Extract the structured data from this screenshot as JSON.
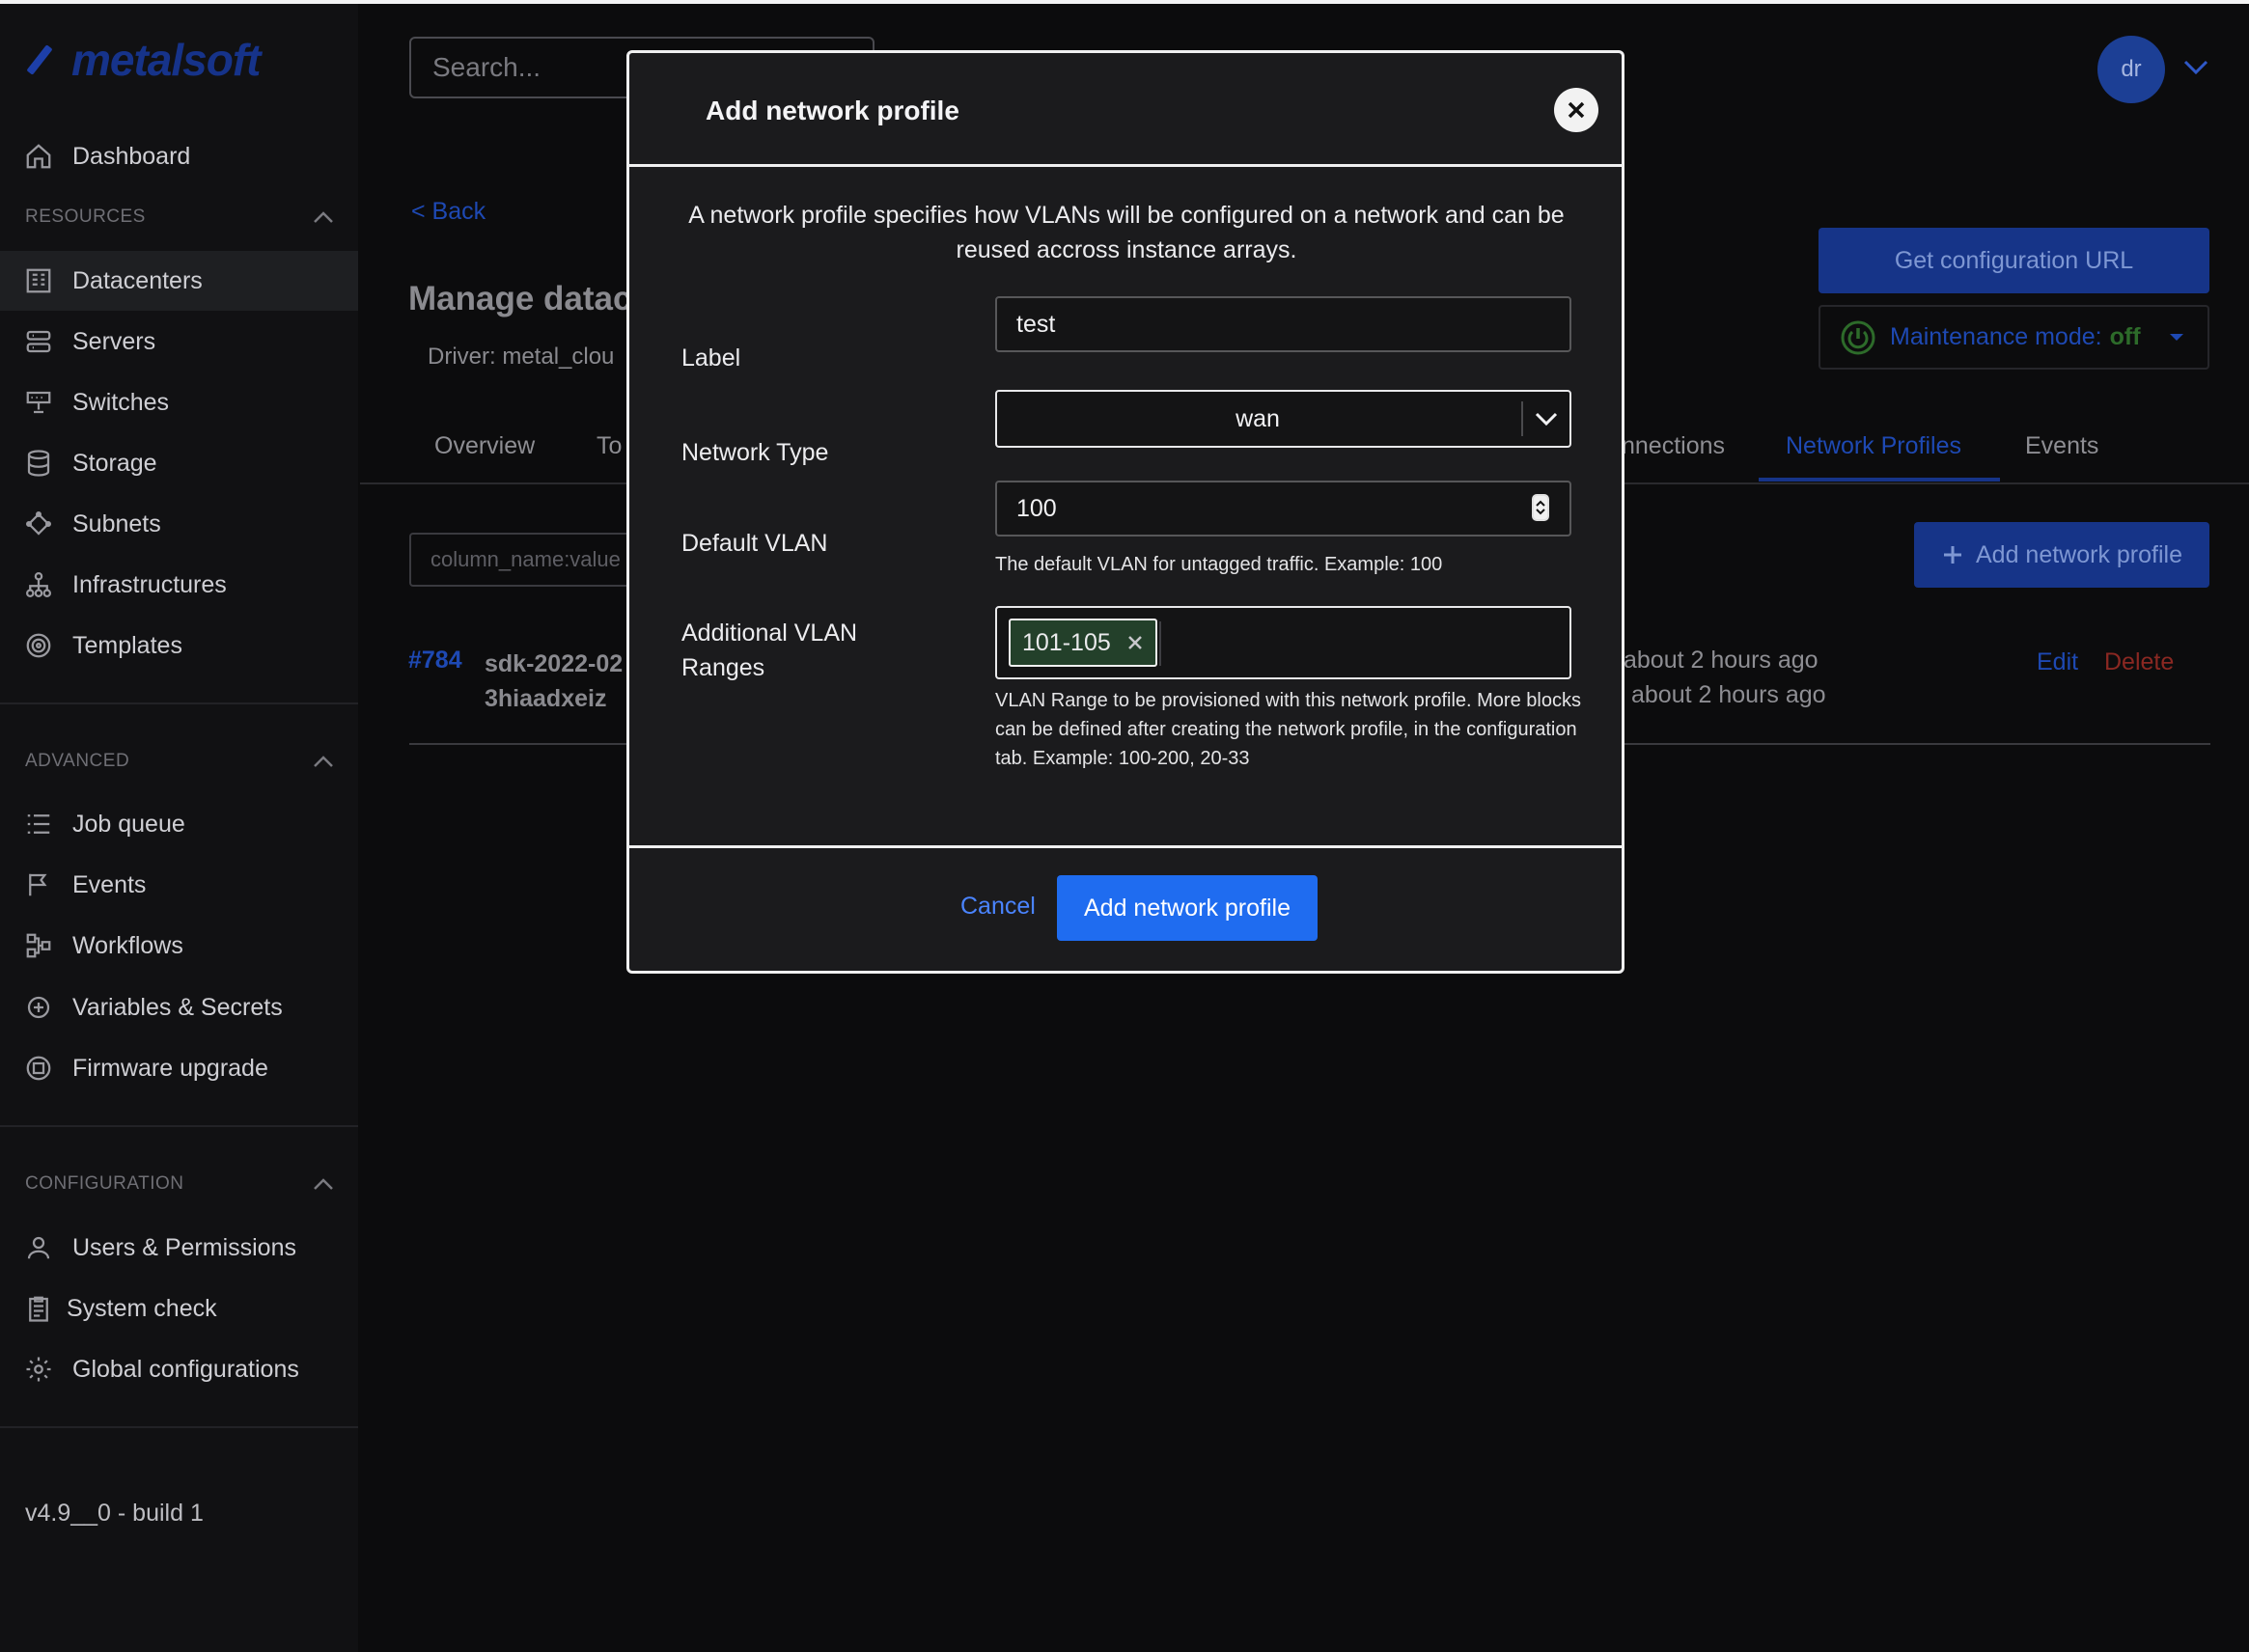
{
  "app": {
    "logo_text": "metalsoft",
    "version": "v4.9__0 - build 1"
  },
  "search": {
    "placeholder": "Search..."
  },
  "user": {
    "initials": "dr"
  },
  "sidebar": {
    "items": [
      {
        "label": "Dashboard",
        "icon": "home-icon"
      },
      {
        "label": "Datacenters",
        "icon": "building-icon"
      },
      {
        "label": "Servers",
        "icon": "server-icon"
      },
      {
        "label": "Switches",
        "icon": "switch-icon"
      },
      {
        "label": "Storage",
        "icon": "database-icon"
      },
      {
        "label": "Subnets",
        "icon": "subnet-icon"
      },
      {
        "label": "Infrastructures",
        "icon": "hierarchy-icon"
      },
      {
        "label": "Templates",
        "icon": "templates-icon"
      },
      {
        "label": "Job queue",
        "icon": "list-icon"
      },
      {
        "label": "Events",
        "icon": "flag-icon"
      },
      {
        "label": "Workflows",
        "icon": "workflow-icon"
      },
      {
        "label": "Variables & Secrets",
        "icon": "secrets-icon"
      },
      {
        "label": "Firmware upgrade",
        "icon": "firmware-icon"
      },
      {
        "label": "Users & Permissions",
        "icon": "user-icon"
      },
      {
        "label": "System check",
        "icon": "clipboard-icon"
      },
      {
        "label": "Global configurations",
        "icon": "gear-icon"
      }
    ],
    "sections": {
      "resources": "RESOURCES",
      "advanced": "ADVANCED",
      "configuration": "CONFIGURATION"
    }
  },
  "page": {
    "back": "< Back",
    "title": "Manage datac",
    "driver": "Driver:  metal_clou",
    "get_config_button": "Get configuration URL",
    "maintenance_label": "Maintenance mode:",
    "maintenance_value": "off",
    "tabs": [
      "Overview",
      "To",
      "nnections",
      "Network Profiles",
      "Events"
    ],
    "filter_placeholder": "column_name:value",
    "add_button": "Add network profile",
    "row": {
      "id": "#784",
      "name_line1": "sdk-2022-02",
      "name_line2": "3hiaadxeiz",
      "created": "about 2 hours ago",
      "updated": "about 2 hours ago",
      "edit": "Edit",
      "delete": "Delete"
    }
  },
  "modal": {
    "title": "Add network profile",
    "description": "A network profile specifies how VLANs will be configured on a network and can be reused accross instance arrays.",
    "label_field": {
      "label": "Label",
      "value": "test"
    },
    "network_type": {
      "label": "Network Type",
      "value": "wan"
    },
    "default_vlan": {
      "label": "Default VLAN",
      "value": "100",
      "help": "The default VLAN for untagged traffic. Example: 100"
    },
    "additional_vlan": {
      "label_line1": "Additional VLAN",
      "label_line2": "Ranges",
      "tags": [
        "101-105"
      ],
      "help": "VLAN Range to be provisioned with this network profile. More blocks can be defined after creating the network profile, in the configuration tab. Example: 100-200, 20-33"
    },
    "cancel": "Cancel",
    "submit": "Add network profile"
  },
  "colors": {
    "accent": "#1f6cf0",
    "link": "#4a84ff",
    "tag_bg": "#23402a"
  }
}
